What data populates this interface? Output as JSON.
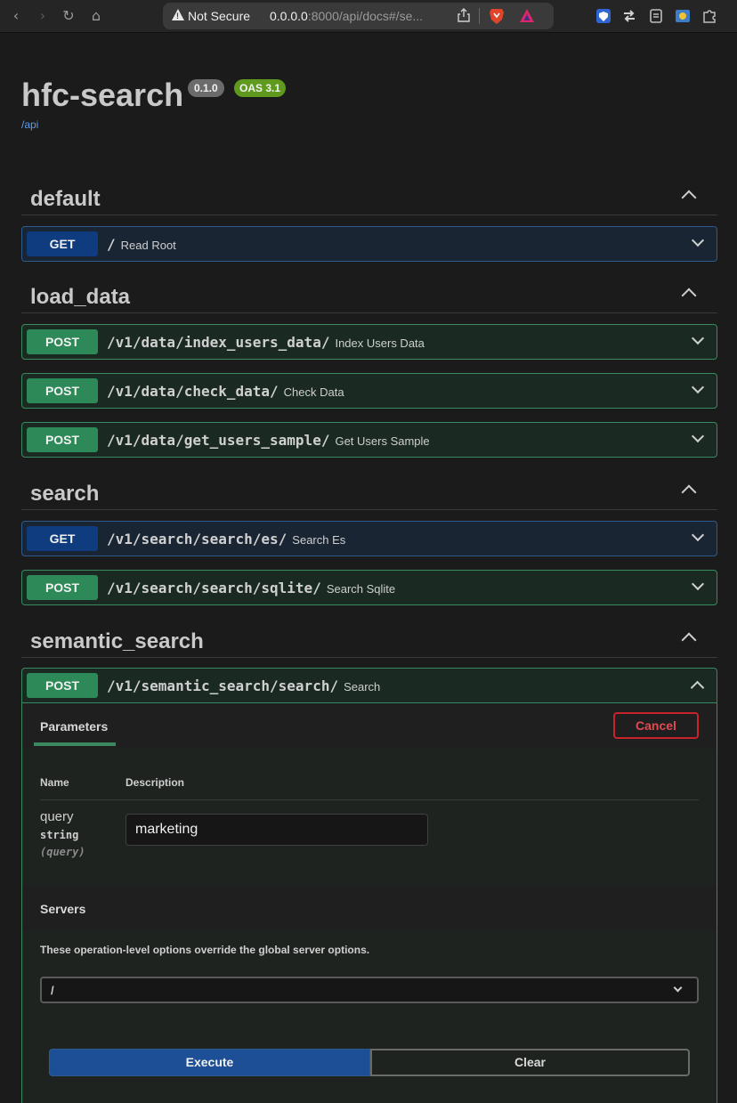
{
  "browser": {
    "security_label": "Not Secure",
    "url_main": "0.0.0.0",
    "url_rest": ":8000/api/docs#/se..."
  },
  "app": {
    "title": "hfc-search",
    "version": "0.1.0",
    "oas": "OAS 3.1",
    "base_url": "/api"
  },
  "tags": [
    {
      "name": "default"
    },
    {
      "name": "load_data"
    },
    {
      "name": "search"
    },
    {
      "name": "semantic_search"
    }
  ],
  "operations": [
    {
      "method": "GET",
      "path": "/",
      "summary": "Read Root"
    },
    {
      "method": "POST",
      "path": "/v1/data/index_users_data/",
      "summary": "Index Users Data"
    },
    {
      "method": "POST",
      "path": "/v1/data/check_data/",
      "summary": "Check Data"
    },
    {
      "method": "POST",
      "path": "/v1/data/get_users_sample/",
      "summary": "Get Users Sample"
    },
    {
      "method": "GET",
      "path": "/v1/search/search/es/",
      "summary": "Search Es"
    },
    {
      "method": "POST",
      "path": "/v1/search/search/sqlite/",
      "summary": "Search Sqlite"
    },
    {
      "method": "POST",
      "path": "/v1/semantic_search/search/",
      "summary": "Search"
    }
  ],
  "expanded": {
    "params_tab": "Parameters",
    "cancel_label": "Cancel",
    "col_name": "Name",
    "col_description": "Description",
    "param": {
      "name": "query",
      "type": "string",
      "in": "(query)",
      "value": "marketing"
    },
    "servers_title": "Servers",
    "servers_note": "These operation-level options override the global server options.",
    "server_selected": "/",
    "execute_label": "Execute",
    "clear_label": "Clear"
  },
  "colors": {
    "get": "#0f3c7f",
    "post": "#2d8a58",
    "cancel": "#c8222a",
    "execute": "#1d4f96"
  }
}
